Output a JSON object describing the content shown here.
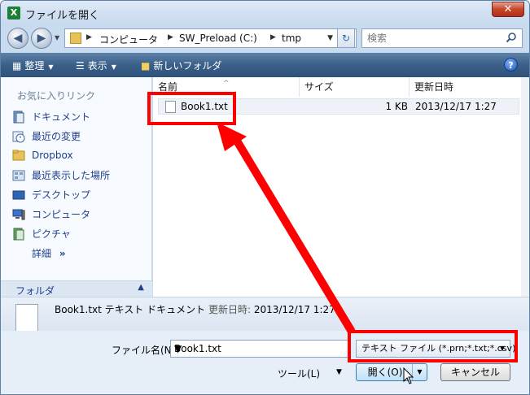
{
  "window": {
    "title": "ファイルを開く",
    "app_icon_letter": "X",
    "close_glyph": "✕"
  },
  "nav": {
    "back_glyph": "◀",
    "forward_glyph": "▶",
    "breadcrumbs": [
      "コンピュータ",
      "SW_Preload (C:)",
      "tmp"
    ],
    "refresh_glyph": "↻",
    "search_placeholder": "検索"
  },
  "toolbar": {
    "organize": "整理",
    "view": "表示",
    "new_folder": "新しいフォルダ",
    "help": "?"
  },
  "sidebar": {
    "favorites_header": "お気に入りリンク",
    "items": [
      {
        "label": "ドキュメント",
        "icon": "documents-icon"
      },
      {
        "label": "最近の変更",
        "icon": "recent-changes-icon"
      },
      {
        "label": "Dropbox",
        "icon": "dropbox-folder-icon"
      },
      {
        "label": "最近表示した場所",
        "icon": "recent-places-icon"
      },
      {
        "label": "デスクトップ",
        "icon": "desktop-icon"
      },
      {
        "label": "コンピュータ",
        "icon": "computer-icon"
      },
      {
        "label": "ピクチャ",
        "icon": "pictures-icon"
      }
    ],
    "details_link": "詳細",
    "details_chevrons": "»",
    "folders_label": "フォルダ",
    "folders_caret": "▲"
  },
  "file_list": {
    "columns": [
      "名前",
      "サイズ",
      "更新日時"
    ],
    "rows": [
      {
        "name": "Book1.txt",
        "size": "1 KB",
        "modified": "2013/12/17 1:27"
      }
    ]
  },
  "details_pane": {
    "filename": "Book1.txt",
    "type": "テキスト ドキュメント",
    "modified_label": "更新日時:",
    "modified_value": "2013/12/17 1:27"
  },
  "bottom": {
    "filename_label": "ファイル名(N):",
    "filename_value": "Book1.txt",
    "file_type_filter": "テキスト ファイル (*.prn;*.txt;*.csv)",
    "tools_label": "ツール(L)",
    "open_label": "開く(O)",
    "cancel_label": "キャンセル"
  },
  "colors": {
    "annotation": "#ff0000",
    "toolbar": "#3a5f89",
    "link": "#1e3f8a"
  }
}
